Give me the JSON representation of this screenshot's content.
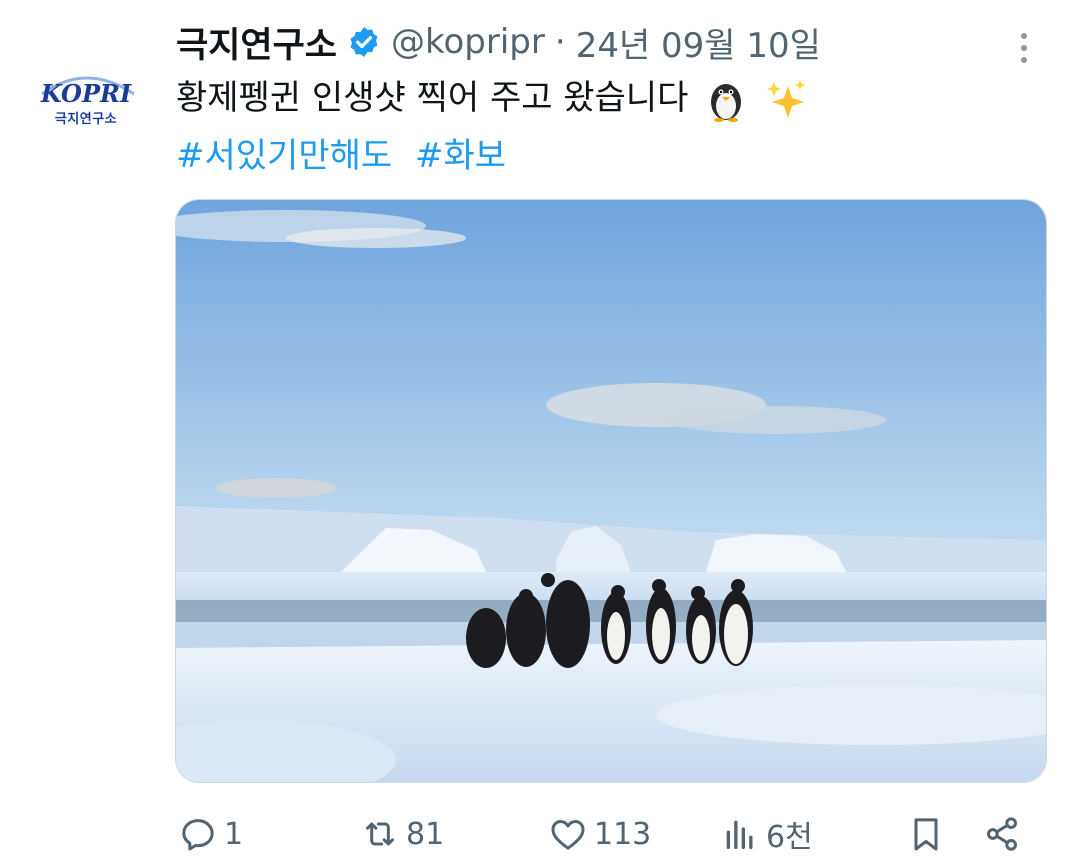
{
  "account": {
    "display_name": "극지연구소",
    "handle": "@kopripr",
    "separator": "·",
    "date": "24년 09월 10일",
    "logo_text": "KOPRI",
    "logo_subtext": "극지연구소",
    "verified_icon": "verified-badge-icon"
  },
  "tweet": {
    "text": "황제펭귄 인생샷 찍어 주고 왔습니다",
    "emojis": [
      "penguin-emoji",
      "sparkles-emoji"
    ],
    "hashtags": [
      "#서있기만해도",
      "#화보"
    ]
  },
  "media": {
    "description_icon": "photo"
  },
  "actions": {
    "reply_count": "1",
    "retweet_count": "81",
    "like_count": "113",
    "views_count": "6천"
  },
  "colors": {
    "accent": "#1d9bf0",
    "secondary_text": "#536471",
    "primary_text": "#0f1419",
    "brand": "#1a3c95"
  }
}
